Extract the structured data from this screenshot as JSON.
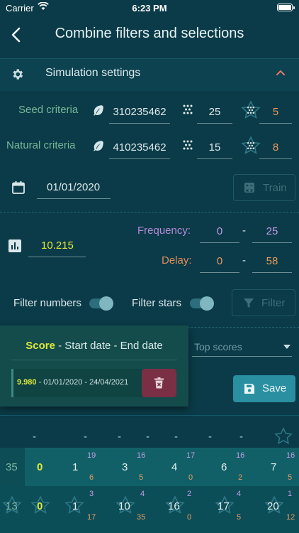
{
  "status": {
    "carrier": "Carrier",
    "time": "6:23 PM"
  },
  "nav": {
    "title": "Combine filters and selections"
  },
  "settings": {
    "title": "Simulation settings"
  },
  "seed": {
    "label": "Seed criteria",
    "value": "310235462",
    "count": "25",
    "stars": "5"
  },
  "natural": {
    "label": "Natural criteria",
    "value": "410235462",
    "count": "15",
    "stars": "8"
  },
  "date": {
    "value": "01/01/2020",
    "train_label": "Train"
  },
  "stats": {
    "value": "10.215",
    "frequency_label": "Frequency:",
    "frequency_min": "0",
    "frequency_max": "25",
    "delay_label": "Delay:",
    "delay_min": "0",
    "delay_max": "58",
    "dash": "-"
  },
  "filters": {
    "numbers_label": "Filter numbers",
    "stars_label": "Filter stars",
    "filter_button": "Filter"
  },
  "scores": {
    "dropdown_placeholder": "Top scores",
    "header_score": "Score",
    "header_rest": " - Start date - End date",
    "item_score": "9.980",
    "item_dates": " - 01/01/2020 - 24/04/2021"
  },
  "save_label": "Save",
  "table": {
    "dashes": [
      "-",
      "-",
      "-",
      "-",
      "-",
      "-",
      "-"
    ],
    "row1": {
      "left": "35",
      "zero": "0",
      "cells": [
        {
          "num": "1",
          "top": "19",
          "bottom": "6"
        },
        {
          "num": "3",
          "top": "16",
          "bottom": "5"
        },
        {
          "num": "4",
          "top": "17",
          "bottom": "0"
        },
        {
          "num": "6",
          "top": "16",
          "bottom": "2"
        },
        {
          "num": "7",
          "top": "16",
          "bottom": "5"
        }
      ]
    },
    "row2": {
      "left": "13",
      "zero": "0",
      "cells": [
        {
          "num": "1",
          "top": "3",
          "bottom": "17"
        },
        {
          "num": "10",
          "top": "4",
          "bottom": "35"
        },
        {
          "num": "16",
          "top": "2",
          "bottom": "0"
        },
        {
          "num": "17",
          "top": "4",
          "bottom": "5"
        },
        {
          "num": "20",
          "top": "1",
          "bottom": "12"
        }
      ]
    }
  },
  "colors": {
    "background": "#0b3b48",
    "accent": "#2a8fa0",
    "highlight": "#dde83d",
    "delete": "#7a2f45"
  }
}
